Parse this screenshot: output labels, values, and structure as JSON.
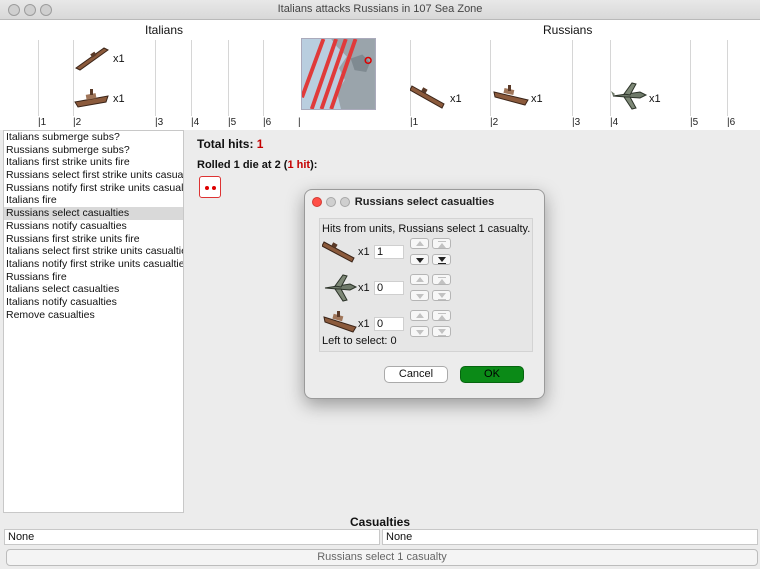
{
  "window": {
    "title": "Italians attacks Russians in 107 Sea Zone"
  },
  "board": {
    "attacker": "Italians",
    "defender": "Russians",
    "attacker_units": [
      {
        "icon": "submarine-icon",
        "count": "x1"
      },
      {
        "icon": "battleship-icon",
        "count": "x1"
      }
    ],
    "defender_units": [
      {
        "icon": "submarine-icon",
        "count": "x1"
      },
      {
        "icon": "battleship-icon",
        "count": "x1"
      },
      {
        "icon": "fighter-plane-icon",
        "count": "x1"
      }
    ],
    "attacker_ticks": [
      "1",
      "2",
      "3",
      "4",
      "5",
      "6"
    ],
    "defender_ticks": [
      "1",
      "2",
      "3",
      "4",
      "5",
      "6"
    ]
  },
  "steps": [
    "Italians submerge subs?",
    "Russians submerge subs?",
    "Italians first strike units fire",
    "Russians select first strike units casualties",
    "Russians notify first strike units casualties",
    "Italians fire",
    "Russians select casualties",
    "Russians notify casualties",
    "Russians first strike units fire",
    "Italians select first strike units casualties",
    "Italians notify first strike units casualties",
    "Russians fire",
    "Italians select casualties",
    "Italians notify casualties",
    "Remove casualties"
  ],
  "selected_step": "Russians select casualties",
  "dice": {
    "total_label": "Total hits:",
    "total_value": "1",
    "rolled_prefix": "Rolled 1 die at 2 (",
    "rolled_hits": "1 hit",
    "rolled_suffix": "):",
    "die_face": 2
  },
  "dialog": {
    "title": "Russians select casualties",
    "message": "Hits from units,  Russians select 1 casualty.",
    "rows": [
      {
        "icon": "submarine-icon",
        "count": "x1",
        "value": "1"
      },
      {
        "icon": "fighter-plane-icon",
        "count": "x1",
        "value": "0"
      },
      {
        "icon": "battleship-icon",
        "count": "x1",
        "value": "0"
      }
    ],
    "left_to_select": "Left to select: 0",
    "cancel_label": "Cancel",
    "ok_label": "OK"
  },
  "casualties": {
    "title": "Casualties",
    "attacker": "None",
    "defender": "None"
  },
  "status": "Russians select 1 casualty",
  "colors": {
    "ok_button": "#0b8a17",
    "hit_red": "#c40000"
  }
}
